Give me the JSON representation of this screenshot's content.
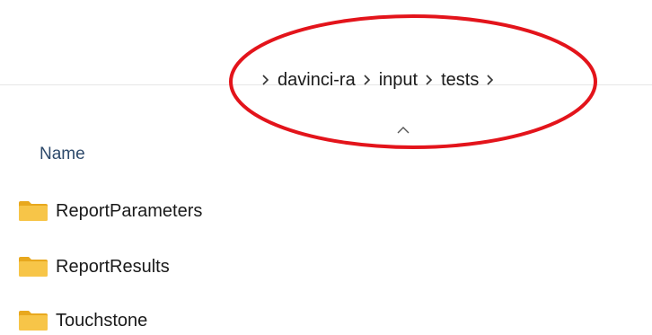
{
  "address_bar": {
    "breadcrumb": [
      {
        "label": "davinci-ra"
      },
      {
        "label": "input"
      },
      {
        "label": "tests"
      }
    ]
  },
  "column_header": {
    "name_label": "Name"
  },
  "files": [
    {
      "name": "ReportParameters",
      "type": "folder",
      "icon": "folder-icon"
    },
    {
      "name": "ReportResults",
      "type": "folder",
      "icon": "folder-icon"
    },
    {
      "name": "Touchstone",
      "type": "folder",
      "icon": "folder-icon"
    }
  ],
  "colors": {
    "highlight_ellipse": "#e3141b",
    "folder_fill": "#f7c548",
    "folder_tab": "#e8a81e",
    "header_text": "#2e4a6b"
  }
}
